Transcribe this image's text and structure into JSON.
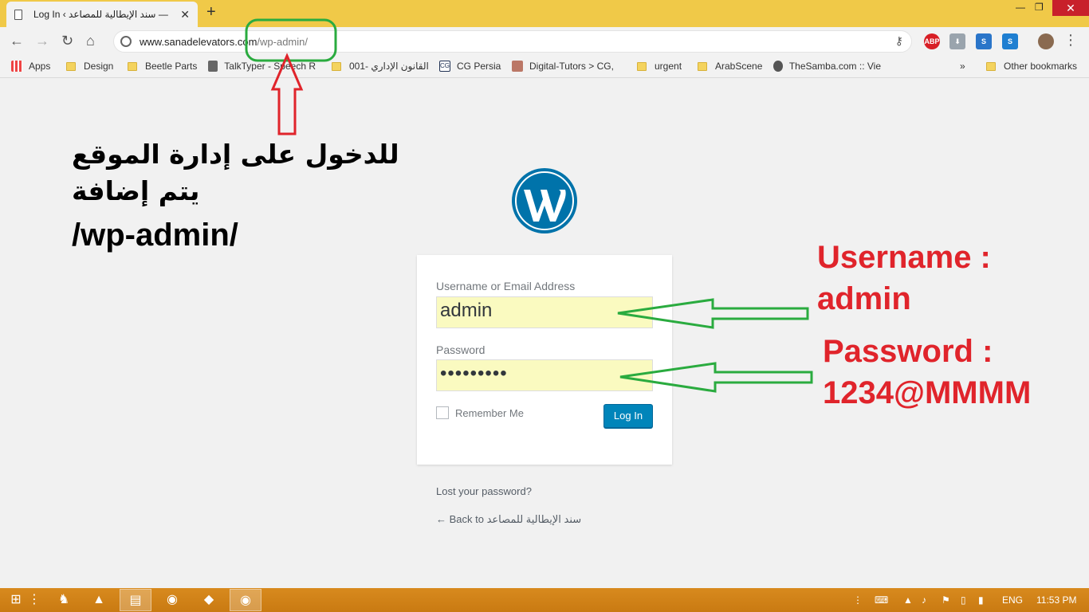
{
  "browser": {
    "tab_title": "Log In ‹ سند الإيطالية للمصاعد —",
    "url_host": "www.sanadelevators.com",
    "url_path": "/wp-admin/",
    "bookmarks": [
      {
        "label": "Apps",
        "kind": "apps"
      },
      {
        "label": "Design",
        "kind": "folder"
      },
      {
        "label": "Beetle Parts",
        "kind": "folder"
      },
      {
        "label": "TalkTyper - Speech R",
        "kind": "site"
      },
      {
        "label": "001- القانون الإداري",
        "kind": "folder"
      },
      {
        "label": "CG Persia",
        "kind": "site"
      },
      {
        "label": "Digital-Tutors > CG, ",
        "kind": "site"
      },
      {
        "label": "urgent",
        "kind": "folder"
      },
      {
        "label": "ArabScene",
        "kind": "folder"
      },
      {
        "label": "TheSamba.com :: Vie",
        "kind": "site"
      },
      {
        "label": "Other bookmarks",
        "kind": "folder"
      }
    ],
    "overflow": "»",
    "extensions": [
      "ABP"
    ]
  },
  "annotations": {
    "arabic_instruction": "للدخول على إدارة الموقع يتم إضافة",
    "path_text": "/wp-admin/",
    "username_line1": "Username :",
    "username_line2": "admin",
    "password_line1": "Password :",
    "password_line2": "1234@MMMM",
    "colors": {
      "red": "#e0242b",
      "green": "#2aab3f"
    }
  },
  "login": {
    "username_label": "Username or Email Address",
    "username_value": "admin",
    "password_label": "Password",
    "password_value": "•••••••••",
    "remember_label": "Remember Me",
    "login_button": "Log In",
    "lost_password": "Lost your password?",
    "back_link": "← Back to سند الإيطالية للمصاعد",
    "accent": "#0085ba"
  },
  "taskbar": {
    "language": "ENG",
    "time": "11:53 PM"
  }
}
